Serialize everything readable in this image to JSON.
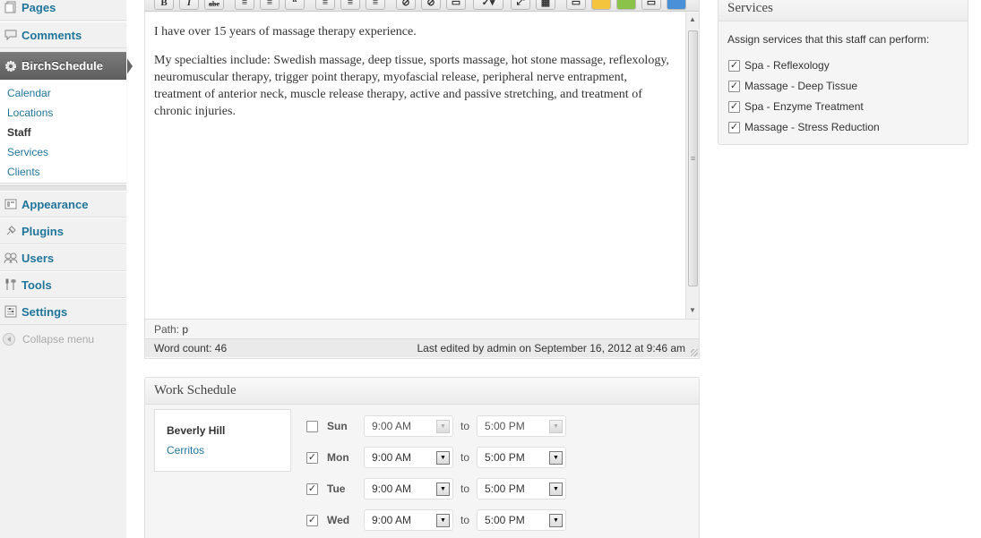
{
  "sidebar": {
    "menu": [
      {
        "label": "Pages",
        "icon": "pages-icon"
      },
      {
        "label": "Comments",
        "icon": "comments-icon"
      },
      {
        "label": "BirchSchedule",
        "icon": "gear-icon"
      },
      {
        "label": "Appearance",
        "icon": "appearance-icon"
      },
      {
        "label": "Plugins",
        "icon": "plugins-icon"
      },
      {
        "label": "Users",
        "icon": "users-icon"
      },
      {
        "label": "Tools",
        "icon": "tools-icon"
      },
      {
        "label": "Settings",
        "icon": "settings-icon"
      }
    ],
    "submenu": [
      "Calendar",
      "Locations",
      "Staff",
      "Services",
      "Clients"
    ],
    "active_submenu": "Staff",
    "collapse_label": "Collapse menu"
  },
  "editor": {
    "paragraphs": [
      "I have over 15 years of massage therapy experience.",
      "My specialties include: Swedish massage, deep tissue, sports massage, hot stone massage, reflexology, neuromuscular therapy, trigger point therapy, myofascial release, peripheral nerve entrapment, treatment of anterior neck, muscle release therapy, active and passive stretching, and treatment of chronic injuries."
    ],
    "path_label": "Path:",
    "path_value": "p",
    "word_count_label": "Word count: 46",
    "last_edited": "Last edited by admin on September 16, 2012 at 9:46 am"
  },
  "schedule": {
    "title": "Work Schedule",
    "locations": [
      "Beverly Hill",
      "Cerritos"
    ],
    "to_label": "to",
    "days": [
      {
        "day": "Sun",
        "checked": false,
        "start": "9:00 AM",
        "end": "5:00 PM"
      },
      {
        "day": "Mon",
        "checked": true,
        "start": "9:00 AM",
        "end": "5:00 PM"
      },
      {
        "day": "Tue",
        "checked": true,
        "start": "9:00 AM",
        "end": "5:00 PM"
      },
      {
        "day": "Wed",
        "checked": true,
        "start": "9:00 AM",
        "end": "5:00 PM"
      }
    ]
  },
  "services": {
    "title": "Services",
    "note": "Assign services that this staff can perform:",
    "items": [
      {
        "label": "Spa - Reflexology",
        "checked": true
      },
      {
        "label": "Massage - Deep Tissue",
        "checked": true
      },
      {
        "label": "Spa - Enzyme Treatment",
        "checked": true
      },
      {
        "label": "Massage - Stress Reduction",
        "checked": true
      }
    ]
  },
  "colors": {
    "link": "#21759b",
    "current_menu_bg": "#6d6d6d",
    "sidebar_bg": "#f1f1f1"
  }
}
